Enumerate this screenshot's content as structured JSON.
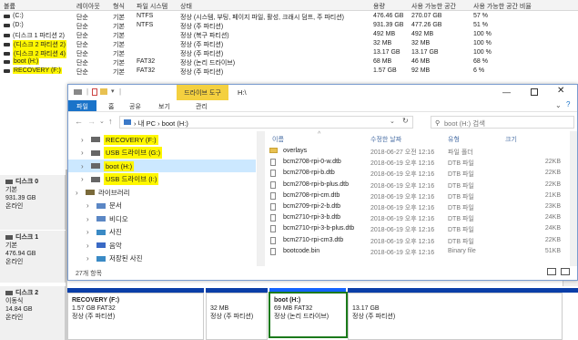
{
  "dm": {
    "headers": [
      "볼륨",
      "레이아웃",
      "형식",
      "파일 시스템",
      "상태",
      "용량",
      "사용 가능한 공간",
      "사용 가능한 공간 비율"
    ],
    "rows": [
      {
        "vol": "(C:)",
        "layout": "단순",
        "type": "기본",
        "fs": "NTFS",
        "status": "정상 (시스템, 부팅, 페이지 파일, 활성, 크래시 덤프, 주 파티션)",
        "cap": "476.46 GB",
        "free": "270.07 GB",
        "pct": "57 %",
        "hl": false
      },
      {
        "vol": "(D:)",
        "layout": "단순",
        "type": "기본",
        "fs": "NTFS",
        "status": "정상 (주 파티션)",
        "cap": "931.39 GB",
        "free": "477.26 GB",
        "pct": "51 %",
        "hl": false
      },
      {
        "vol": "(디스크 1 파티션 2)",
        "layout": "단순",
        "type": "기본",
        "fs": "",
        "status": "정상 (복구 파티션)",
        "cap": "492 MB",
        "free": "492 MB",
        "pct": "100 %",
        "hl": false
      },
      {
        "vol": "(디스크 2 파티션 2)",
        "layout": "단순",
        "type": "기본",
        "fs": "",
        "status": "정상 (주 파티션)",
        "cap": "32 MB",
        "free": "32 MB",
        "pct": "100 %",
        "hl": true
      },
      {
        "vol": "(디스크 2 파티션 4)",
        "layout": "단순",
        "type": "기본",
        "fs": "",
        "status": "정상 (주 파티션)",
        "cap": "13.17 GB",
        "free": "13.17 GB",
        "pct": "100 %",
        "hl": true
      },
      {
        "vol": "boot (H:)",
        "layout": "단순",
        "type": "기본",
        "fs": "FAT32",
        "status": "정상 (논리 드라이브)",
        "cap": "68 MB",
        "free": "46 MB",
        "pct": "68 %",
        "hl": true
      },
      {
        "vol": "RECOVERY (F:)",
        "layout": "단순",
        "type": "기본",
        "fs": "FAT32",
        "status": "정상 (주 파티션)",
        "cap": "1.57 GB",
        "free": "92 MB",
        "pct": "6 %",
        "hl": true
      }
    ]
  },
  "disks": [
    {
      "name": "디스크 0",
      "type": "기본",
      "size": "931.39 GB",
      "state": "온라인"
    },
    {
      "name": "디스크 1",
      "type": "기본",
      "size": "476.94 GB",
      "state": "온라인"
    },
    {
      "name": "디스크 2",
      "type": "이동식",
      "size": "14.84 GB",
      "state": "온라인"
    }
  ],
  "disk2_parts": [
    {
      "title": "RECOVERY  (F:)",
      "l2": "1.57 GB FAT32",
      "l3": "정상 (주 파티션)"
    },
    {
      "title": "",
      "l2": "32 MB",
      "l3": "정상 (주 파티션)"
    },
    {
      "title": "boot  (H:)",
      "l2": "69 MB FAT32",
      "l3": "정상 (논리 드라이브)"
    },
    {
      "title": "",
      "l2": "13.17 GB",
      "l3": "정상 (주 파티션)"
    }
  ],
  "explorer": {
    "context_tab": "드라이브 도구",
    "title": "H:\\",
    "tabs": [
      "파일",
      "홈",
      "공유",
      "보기",
      "관리"
    ],
    "address": "› 내 PC › boot (H:)",
    "search_placeholder": "boot (H:) 검색",
    "nav": [
      {
        "label": "RECOVERY (F:)",
        "hl": true,
        "sel": false,
        "icon": "drive",
        "indent": 0
      },
      {
        "label": "USB 드라이브 (G:)",
        "hl": true,
        "sel": false,
        "icon": "drive",
        "indent": 0
      },
      {
        "label": "boot (H:)",
        "hl": true,
        "sel": true,
        "icon": "drive",
        "indent": 0
      },
      {
        "label": "USB 드라이브 (I:)",
        "hl": true,
        "sel": false,
        "icon": "drive",
        "indent": 0
      },
      {
        "label": "라이브러리",
        "hl": false,
        "sel": false,
        "icon": "library",
        "indent": -1
      },
      {
        "label": "문서",
        "hl": false,
        "sel": false,
        "icon": "doc",
        "indent": 1
      },
      {
        "label": "비디오",
        "hl": false,
        "sel": false,
        "icon": "video",
        "indent": 1
      },
      {
        "label": "사진",
        "hl": false,
        "sel": false,
        "icon": "photo",
        "indent": 1
      },
      {
        "label": "음악",
        "hl": false,
        "sel": false,
        "icon": "music",
        "indent": 1
      },
      {
        "label": "저장된 사진",
        "hl": false,
        "sel": false,
        "icon": "photo",
        "indent": 1
      }
    ],
    "cols": [
      "이름",
      "수정한 날짜",
      "유형",
      "크기"
    ],
    "files": [
      {
        "name": "overlays",
        "date": "2018-06-27 오전 12:16",
        "type": "파일 폴더",
        "size": "",
        "folder": true
      },
      {
        "name": "bcm2708-rpi-0-w.dtb",
        "date": "2018-06-19 오후 12:16",
        "type": "DTB 파일",
        "size": "22KB",
        "folder": false
      },
      {
        "name": "bcm2708-rpi-b.dtb",
        "date": "2018-06-19 오후 12:16",
        "type": "DTB 파일",
        "size": "22KB",
        "folder": false
      },
      {
        "name": "bcm2708-rpi-b-plus.dtb",
        "date": "2018-06-19 오후 12:16",
        "type": "DTB 파일",
        "size": "22KB",
        "folder": false
      },
      {
        "name": "bcm2708-rpi-cm.dtb",
        "date": "2018-06-19 오후 12:16",
        "type": "DTB 파일",
        "size": "21KB",
        "folder": false
      },
      {
        "name": "bcm2709-rpi-2-b.dtb",
        "date": "2018-06-19 오후 12:16",
        "type": "DTB 파일",
        "size": "23KB",
        "folder": false
      },
      {
        "name": "bcm2710-rpi-3-b.dtb",
        "date": "2018-06-19 오후 12:16",
        "type": "DTB 파일",
        "size": "24KB",
        "folder": false
      },
      {
        "name": "bcm2710-rpi-3-b-plus.dtb",
        "date": "2018-06-19 오후 12:16",
        "type": "DTB 파일",
        "size": "24KB",
        "folder": false
      },
      {
        "name": "bcm2710-rpi-cm3.dtb",
        "date": "2018-06-19 오후 12:16",
        "type": "DTB 파일",
        "size": "22KB",
        "folder": false
      },
      {
        "name": "bootcode.bin",
        "date": "2018-06-19 오후 12:16",
        "type": "Binary file",
        "size": "51KB",
        "folder": false
      }
    ],
    "status": "27개 항목"
  },
  "colors": {
    "highlight": "#fff700",
    "select": "#cce8ff",
    "bar": "#0a3ea8",
    "accent": "#1b7a1b",
    "context_tab": "#f4d03f"
  }
}
